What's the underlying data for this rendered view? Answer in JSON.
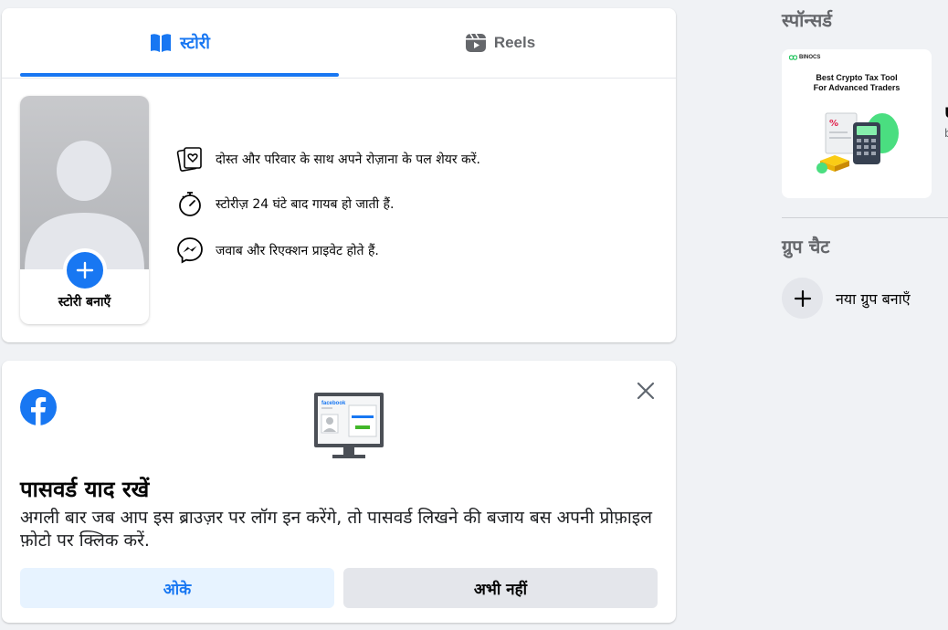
{
  "stories_card": {
    "tabs": [
      {
        "label": "स्टोरी",
        "icon": "book-open-icon",
        "active": true
      },
      {
        "label": "Reels",
        "icon": "reels-icon",
        "active": false
      }
    ],
    "create_story_label": "स्टोरी बनाएँ",
    "info_items": [
      {
        "icon": "photo-heart-icon",
        "text": "दोस्त और परिवार के साथ अपने रोज़ाना के पल शेयर करें."
      },
      {
        "icon": "stopwatch-icon",
        "text": "स्टोरीज़ 24 घंटे बाद गायब हो जाती हैं."
      },
      {
        "icon": "messenger-icon",
        "text": "जवाब और रिएक्शन प्राइवेट होते हैं."
      }
    ]
  },
  "password_card": {
    "title": "पासवर्ड याद रखें",
    "description": "अगली बार जब आप इस ब्राउज़र पर लॉग इन करेंगे, तो पासवर्ड लिखने की बजाय बस अपनी प्रोफ़ाइल फ़ोटो पर क्लिक करें.",
    "ok_label": "ओके",
    "not_now_label": "अभी नहीं",
    "monitor_logo_text": "facebook"
  },
  "sidebar": {
    "sponsored_heading": "स्पॉन्सर्ड",
    "ad": {
      "brand": "BINOCS",
      "headline_line1": "Best Crypto Tax Tool",
      "headline_line2": "For Advanced Traders"
    },
    "group_chat_heading": "ग्रुप चैट",
    "new_group_label": "नया ग्रुप बनाएँ"
  },
  "colors": {
    "accent": "#1877f2",
    "background": "#f0f2f5"
  }
}
